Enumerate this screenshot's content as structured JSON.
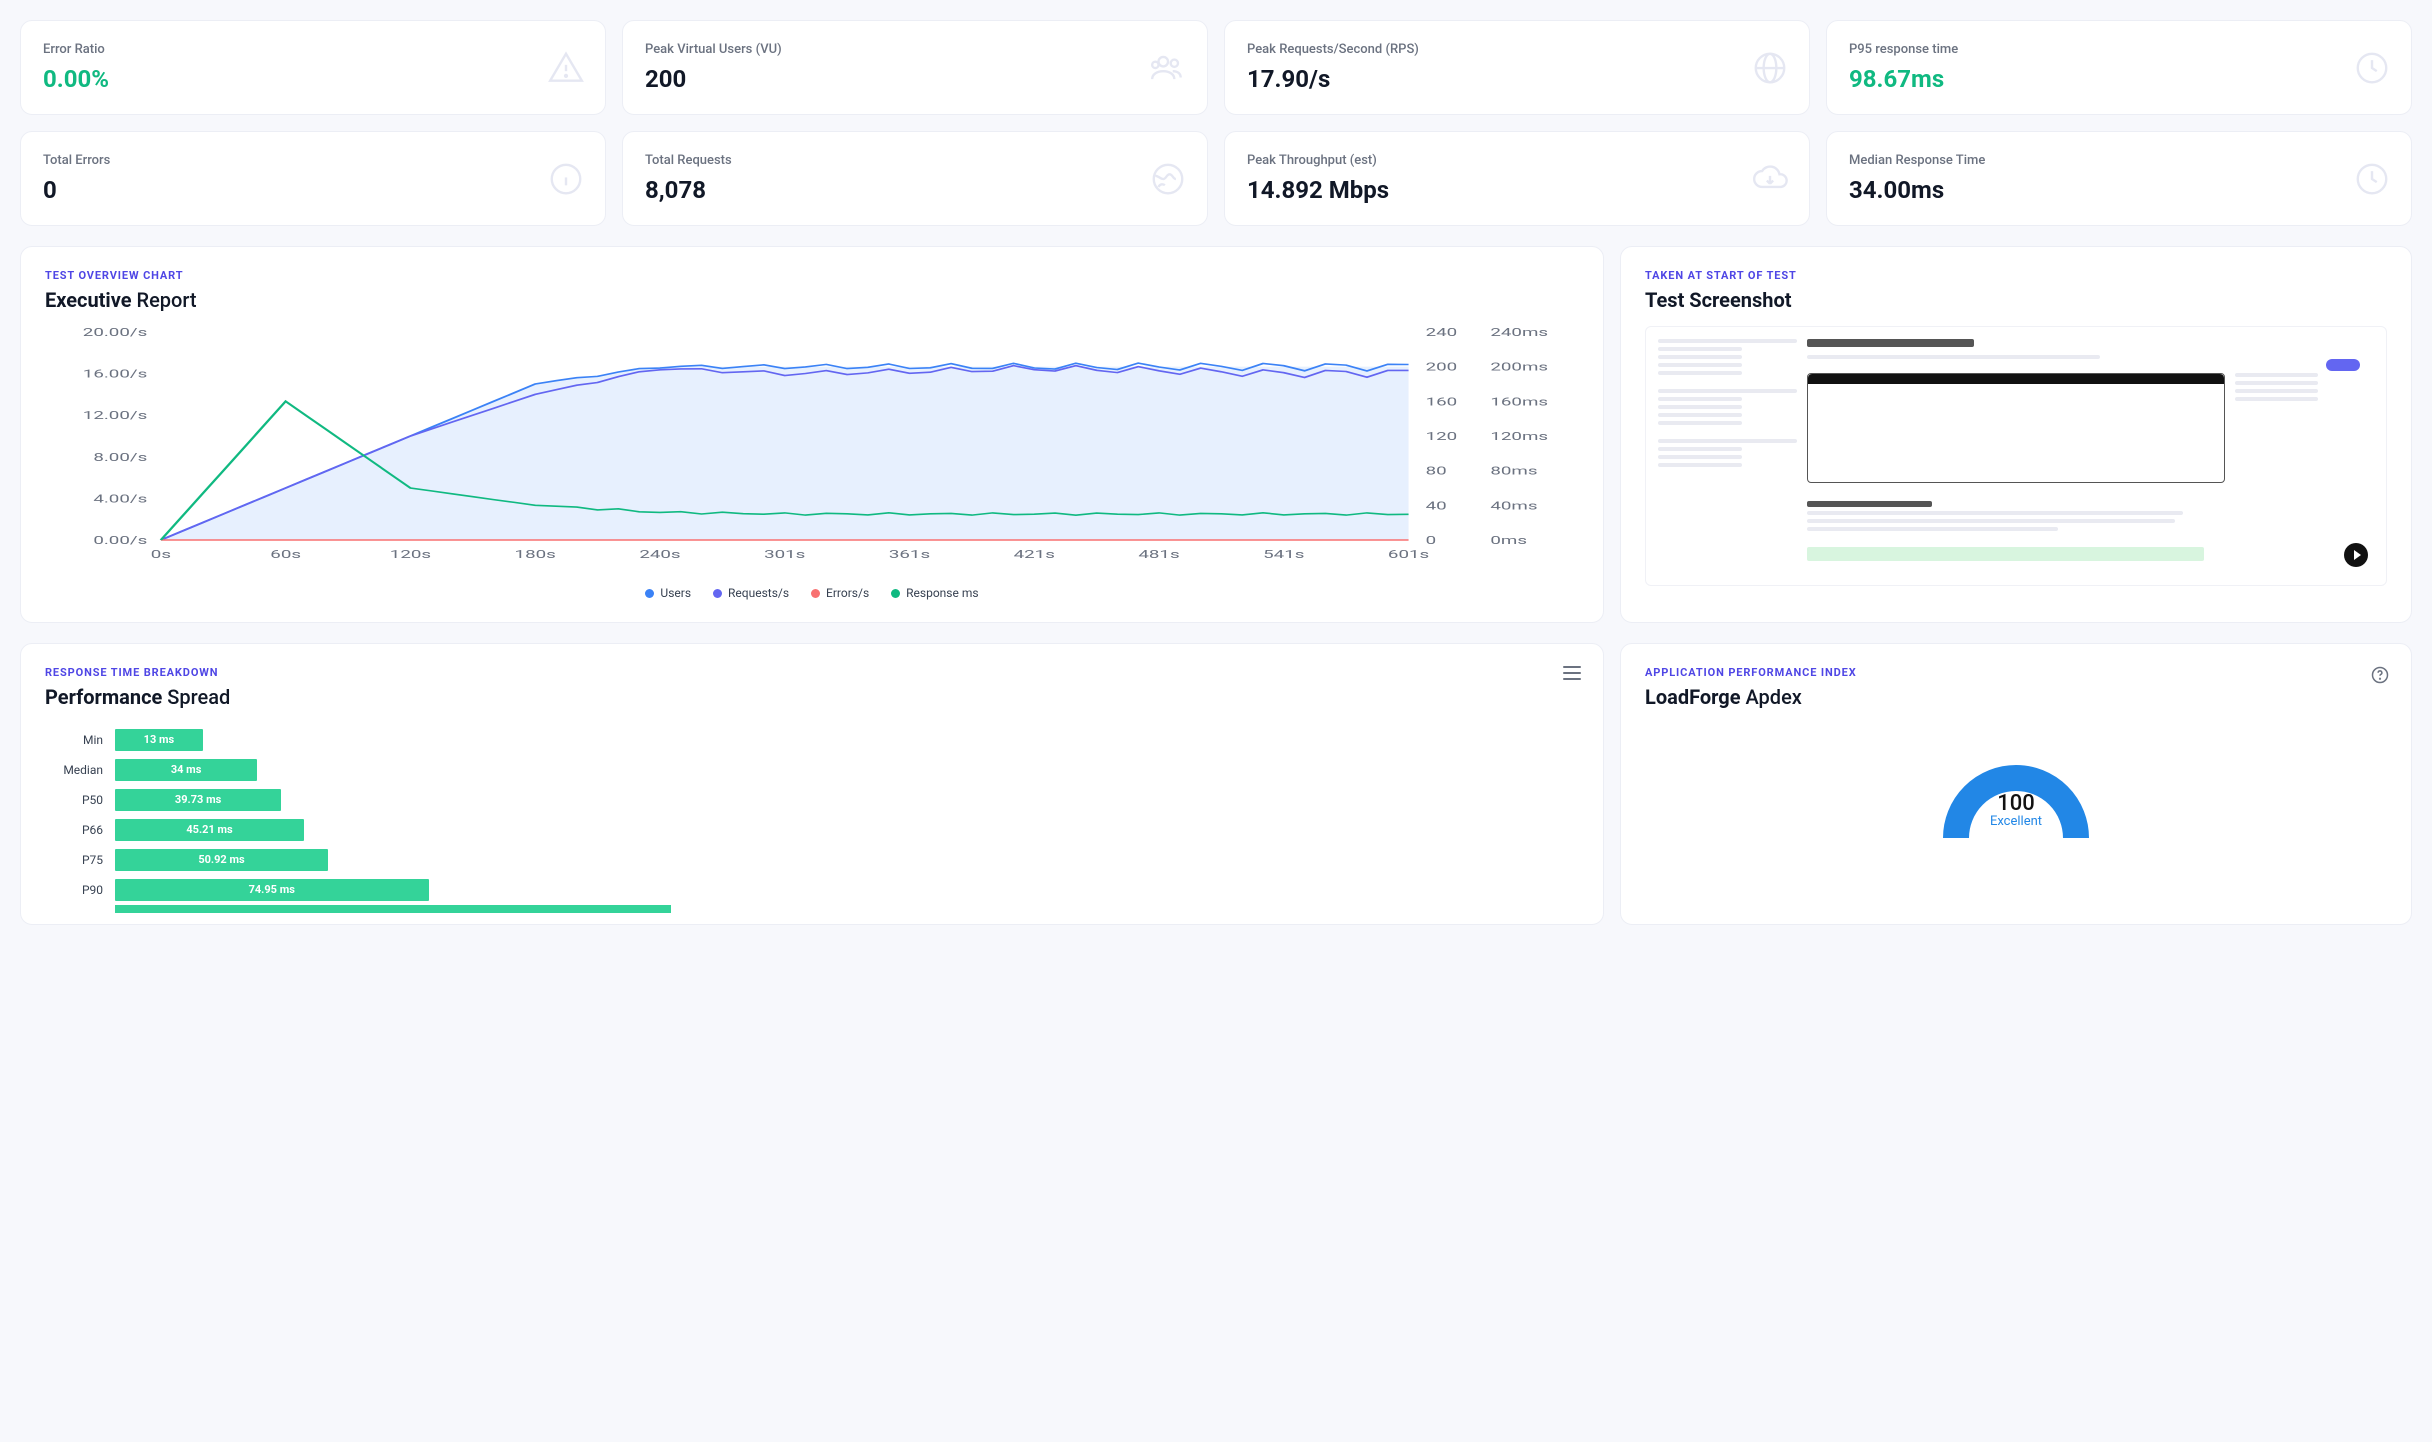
{
  "kpis": [
    {
      "label": "Error Ratio",
      "value": "0.00%",
      "accent": "green",
      "icon": "warning"
    },
    {
      "label": "Peak Virtual Users (VU)",
      "value": "200",
      "accent": "",
      "icon": "users"
    },
    {
      "label": "Peak Requests/Second (RPS)",
      "value": "17.90/s",
      "accent": "",
      "icon": "globe"
    },
    {
      "label": "P95 response time",
      "value": "98.67ms",
      "accent": "green",
      "icon": "clock"
    },
    {
      "label": "Total Errors",
      "value": "0",
      "accent": "",
      "icon": "info"
    },
    {
      "label": "Total Requests",
      "value": "8,078",
      "accent": "",
      "icon": "earth"
    },
    {
      "label": "Peak Throughput (est)",
      "value": "14.892 Mbps",
      "accent": "",
      "icon": "download"
    },
    {
      "label": "Median Response Time",
      "value": "34.00ms",
      "accent": "",
      "icon": "clock"
    }
  ],
  "exec_report": {
    "eyebrow": "TEST OVERVIEW CHART",
    "title_bold": "Executive",
    "title_rest": " Report",
    "legend": [
      {
        "label": "Users",
        "color": "#3b82f6"
      },
      {
        "label": "Requests/s",
        "color": "#6366f1"
      },
      {
        "label": "Errors/s",
        "color": "#f87171"
      },
      {
        "label": "Response ms",
        "color": "#10b981"
      }
    ]
  },
  "chart_data": {
    "type": "line",
    "x_ticks": [
      "0s",
      "60s",
      "120s",
      "180s",
      "240s",
      "301s",
      "361s",
      "421s",
      "481s",
      "541s",
      "601s"
    ],
    "y_left": {
      "label": "Requests/s",
      "ticks": [
        "0.00/s",
        "4.00/s",
        "8.00/s",
        "12.00/s",
        "16.00/s",
        "20.00/s"
      ],
      "min": 0,
      "max": 20
    },
    "y_right1": {
      "label": "Users",
      "ticks": [
        0,
        40,
        80,
        120,
        160,
        200,
        240
      ]
    },
    "y_right2": {
      "label": "Response ms",
      "ticks": [
        "0ms",
        "40ms",
        "80ms",
        "120ms",
        "160ms",
        "200ms",
        "240ms"
      ]
    },
    "series": [
      {
        "name": "Users",
        "color": "#3b82f6",
        "axis": "y_right1",
        "fill": true,
        "values": [
          0,
          60,
          120,
          180,
          200,
          200,
          200,
          200,
          200,
          200,
          200
        ]
      },
      {
        "name": "Requests/s",
        "color": "#6366f1",
        "axis": "y_left",
        "fill": false,
        "values": [
          0,
          5,
          10,
          14,
          16.5,
          16,
          16.2,
          16.5,
          16.3,
          16,
          16.1
        ]
      },
      {
        "name": "Errors/s",
        "color": "#f87171",
        "axis": "y_left",
        "fill": false,
        "values": [
          0,
          0,
          0,
          0,
          0,
          0,
          0,
          0,
          0,
          0,
          0
        ]
      },
      {
        "name": "Response ms",
        "color": "#10b981",
        "axis": "y_right2",
        "fill": false,
        "values": [
          0,
          160,
          60,
          40,
          32,
          30,
          30,
          30,
          30,
          30,
          30
        ]
      }
    ]
  },
  "screenshot": {
    "eyebrow": "TAKEN AT START OF TEST",
    "title": "Test Screenshot"
  },
  "perf_spread": {
    "eyebrow": "RESPONSE TIME BREAKDOWN",
    "title_bold": "Performance",
    "title_rest": " Spread",
    "max_scale": 350,
    "rows": [
      {
        "label": "Min",
        "text": "13 ms",
        "value": 13
      },
      {
        "label": "Median",
        "text": "34 ms",
        "value": 34
      },
      {
        "label": "P50",
        "text": "39.73 ms",
        "value": 39.73
      },
      {
        "label": "P66",
        "text": "45.21 ms",
        "value": 45.21
      },
      {
        "label": "P75",
        "text": "50.92 ms",
        "value": 50.92
      },
      {
        "label": "P90",
        "text": "74.95 ms",
        "value": 74.95
      }
    ]
  },
  "apdex": {
    "eyebrow": "APPLICATION PERFORMANCE INDEX",
    "title_bold": "LoadForge",
    "title_rest": " Apdex",
    "score": "100",
    "rating": "Excellent"
  }
}
